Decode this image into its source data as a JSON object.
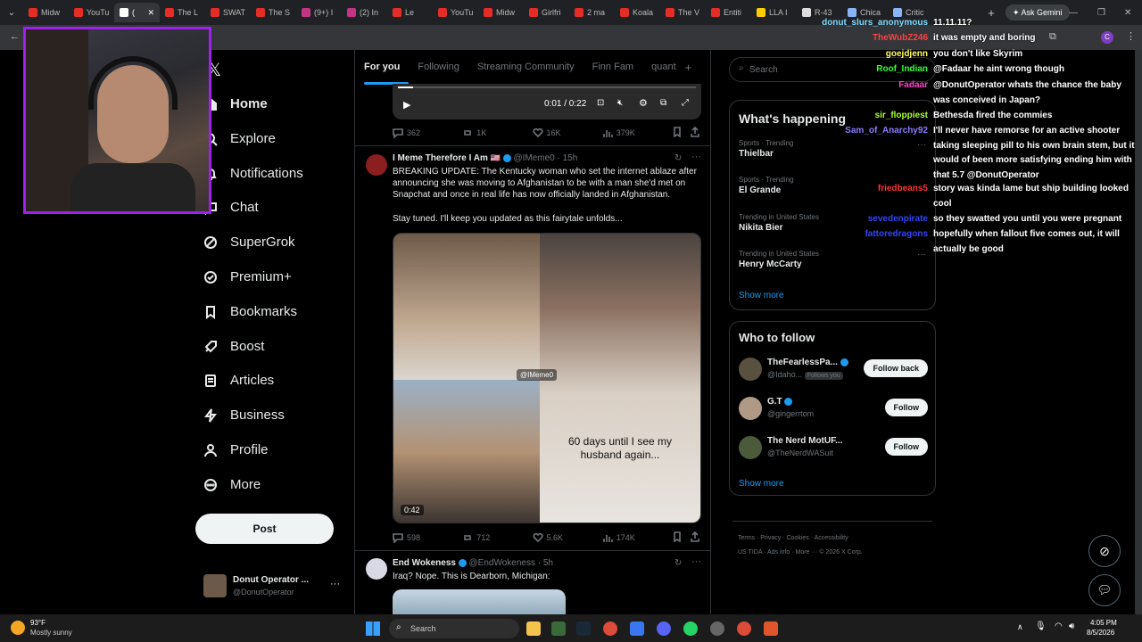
{
  "browser": {
    "tabs": [
      {
        "label": "Midw",
        "color": "#e52d27"
      },
      {
        "label": "YouTu",
        "color": "#e52d27"
      },
      {
        "label": "(",
        "color": "#ffffff"
      },
      {
        "label": "The L",
        "color": "#e52d27"
      },
      {
        "label": "SWAT",
        "color": "#e52d27"
      },
      {
        "label": "The S",
        "color": "#e52d27"
      },
      {
        "label": "(9+) I",
        "color": "#c13584"
      },
      {
        "label": "(2) In",
        "color": "#c13584"
      },
      {
        "label": "Le",
        "color": "#e52d27"
      },
      {
        "label": "YouTu",
        "color": "#e52d27"
      },
      {
        "label": "Midw",
        "color": "#e52d27"
      },
      {
        "label": "Girlfri",
        "color": "#e52d27"
      },
      {
        "label": "2 ma",
        "color": "#e52d27"
      },
      {
        "label": "Koala",
        "color": "#e52d27"
      },
      {
        "label": "The V",
        "color": "#e52d27"
      },
      {
        "label": "Entiti",
        "color": "#e52d27"
      },
      {
        "label": "LLA I",
        "color": "#ffcc00"
      },
      {
        "label": "R-43",
        "color": "#dddddd"
      },
      {
        "label": "Chica",
        "color": "#8ab4f8"
      },
      {
        "label": "Critic",
        "color": "#8ab4f8"
      }
    ],
    "ask_gemini": "Ask Gemini"
  },
  "feed_tabs": [
    "For you",
    "Following",
    "Streaming Community",
    "Finn Fam",
    "quant"
  ],
  "left_nav": {
    "items": [
      "Home",
      "Explore",
      "Notifications",
      "Chat",
      "SuperGrok",
      "Premium+",
      "Bookmarks",
      "Boost",
      "Articles",
      "Business",
      "Profile",
      "More"
    ],
    "post_label": "Post",
    "account_name": "Donut Operator ...",
    "account_handle": "@DonutOperator"
  },
  "video_top": {
    "time": "0:01 / 0:22"
  },
  "tweet1_stats": {
    "replies": "362",
    "reposts": "1K",
    "likes": "16K",
    "views": "379K"
  },
  "tweet2": {
    "name": "I Meme Therefore I Am",
    "handle": "@IMeme0 · 15h",
    "text": "BREAKING UPDATE: The Kentucky woman who set the internet ablaze after announcing she was moving to Afghanistan to be with a man she'd met on Snapchat and once in real life has now officially landed in Afghanistan.",
    "text2": "Stay tuned. I'll keep you updated as this fairytale unfolds...",
    "media_watermark": "@IMeme0",
    "media_caption": "60 days until I see my husband again...",
    "duration": "0:42",
    "replies": "598",
    "reposts": "712",
    "likes": "5.6K",
    "views": "174K"
  },
  "tweet3": {
    "name": "End Wokeness",
    "handle": "@EndWokeness · 5h",
    "text": "Iraq? Nope. This is Dearborn, Michigan:"
  },
  "search": {
    "placeholder": "Search"
  },
  "whats_happening": {
    "title": "What's happening",
    "trends": [
      {
        "category": "Sports · Trending",
        "name": "Thielbar"
      },
      {
        "category": "Sports · Trending",
        "name": "El Grande"
      },
      {
        "category": "Trending in United States",
        "name": "Nikita Bier"
      },
      {
        "category": "Trending in United States",
        "name": "Henry McCarty"
      }
    ],
    "show_more": "Show more"
  },
  "who_to_follow": {
    "title": "Who to follow",
    "accounts": [
      {
        "name": "TheFearlessPa...",
        "handle": "@Idaho...",
        "badge": "Follows you",
        "button": "Follow back"
      },
      {
        "name": "G.T",
        "handle": "@gingerrtom",
        "badge": "",
        "button": "Follow"
      },
      {
        "name": "The Nerd MotUF...",
        "handle": "@TheNerdWASuit",
        "badge": "",
        "button": "Follow"
      }
    ],
    "show_more": "Show more"
  },
  "footer_links": [
    "Terms",
    "Privacy",
    "Cookies",
    "Accessibility",
    "US TIDA",
    "Ads info",
    "More ···",
    "© 2026 X Corp."
  ],
  "chat": [
    {
      "user": "donut_slurs_anonymous",
      "color": "#7fdbff",
      "msg": "11.11.11?"
    },
    {
      "user": "TheWubZ246",
      "color": "#ff4040",
      "msg": "it was empty and boring"
    },
    {
      "user": "goejdjenn",
      "color": "#ffff66",
      "msg": "you don't like Skyrim"
    },
    {
      "user": "Roof_Indian",
      "color": "#33ff33",
      "msg": "@Fadaar he aint wrong though"
    },
    {
      "user": "Fadaar",
      "color": "#ff44cc",
      "msg": "@DonutOperator whats the chance the baby was conceived in Japan?"
    },
    {
      "user": "sir_floppiest",
      "color": "#aaff33",
      "msg": "Bethesda fired the commies"
    },
    {
      "user": "Sam_of_Anarchy92",
      "color": "#8a7dff",
      "msg": "I'll never have remorse for an active shooter taking sleeping pill to his own brain stem, but it would of been more satisfying ending him with that 5.7 @DonutOperator"
    },
    {
      "user": "friedbeans5",
      "color": "#ff3333",
      "msg": "story was kinda lame but ship building looked cool"
    },
    {
      "user": "sevedenpirate",
      "color": "#3344ff",
      "msg": "so they swatted you until you were pregnant"
    },
    {
      "user": "fattoredragons",
      "color": "#3344ff",
      "msg": "hopefully when fallout five comes out, it will actually be good"
    }
  ],
  "taskbar": {
    "temp": "93°F",
    "weather": "Mostly sunny",
    "search": "Search",
    "time": "4:05 PM",
    "date": "8/5/2026"
  }
}
